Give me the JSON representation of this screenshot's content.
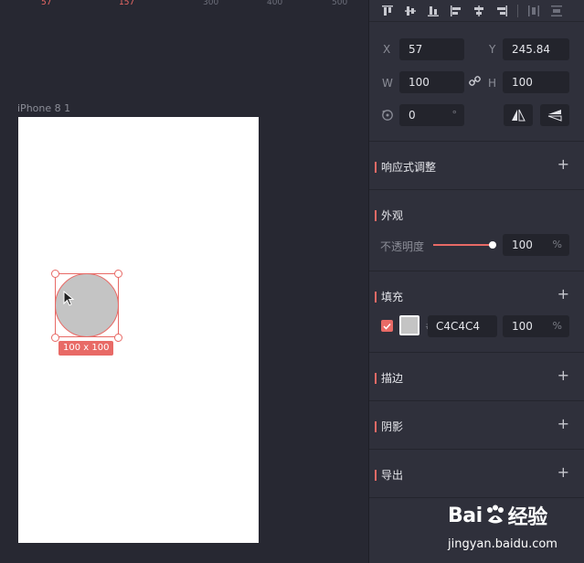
{
  "canvas": {
    "ruler_labels": [
      "57",
      "157",
      "300",
      "400",
      "500"
    ],
    "artboard_name": "iPhone 8 1",
    "selection_size": "100 x 100",
    "shape_fill": "#C4C4C4",
    "accent": "#E86A66"
  },
  "geometry": {
    "x_label": "X",
    "x_value": "57",
    "y_label": "Y",
    "y_value": "245.84",
    "w_label": "W",
    "w_value": "100",
    "h_label": "H",
    "h_value": "100",
    "rotation_value": "0",
    "rotation_unit": "°"
  },
  "sections": {
    "responsive": "响应式调整",
    "appearance": "外观",
    "opacity_label": "不透明度",
    "opacity_value": "100",
    "percent": "%",
    "fill": "填充",
    "fill_hash": "#",
    "fill_hex": "C4C4C4",
    "fill_opacity": "100",
    "stroke": "描边",
    "shadow": "阴影",
    "export": "导出",
    "plus": "+"
  },
  "watermark": {
    "brand_a": "Bai",
    "brand_b": "经验",
    "url": "jingyan.baidu.com"
  }
}
